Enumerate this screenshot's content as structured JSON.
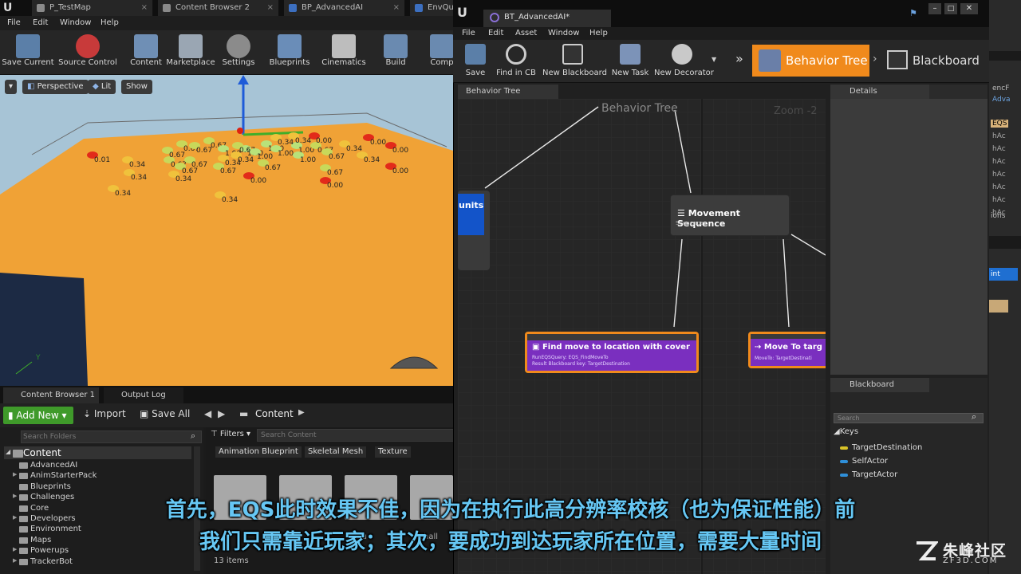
{
  "main_window": {
    "tabs": [
      "P_TestMap",
      "Content Browser 2",
      "BP_AdvancedAI",
      "EnvQu"
    ],
    "menu": [
      "File",
      "Edit",
      "Window",
      "Help"
    ],
    "toolbar": [
      "Save Current",
      "Source Control",
      "Content",
      "Marketplace",
      "Settings",
      "Blueprints",
      "Cinematics",
      "Build",
      "Comp"
    ],
    "viewport": {
      "buttons": [
        "Perspective",
        "Lit",
        "Show"
      ],
      "values": [
        "0.01",
        "0.34",
        "0.34",
        "0.34",
        "0.67",
        "0.67",
        "0.67",
        "0.67",
        "1.00",
        "1.00",
        "1.00",
        "1.00",
        "1.00",
        "0.67",
        "0.67",
        "0.67",
        "0.67",
        "0.67",
        "0.34",
        "0.34",
        "0.34",
        "0.34",
        "0.34",
        "0.00",
        "0.00",
        "0.00",
        "0.00",
        "0.00",
        "0.00",
        "0.34",
        "0.34",
        "0.67",
        "0.67",
        "1.00",
        "0.67",
        "0.34",
        "0.67",
        "1.00"
      ],
      "axis_label": "Y"
    },
    "content_browser": {
      "tabs": [
        "Content Browser 1",
        "Output Log"
      ],
      "add_new": "Add New",
      "import": "Import",
      "save_all": "Save All",
      "path": "Content",
      "search_folders": "Search Folders",
      "filters": "Filters",
      "search_content": "Search Content",
      "filter_chips": [
        "Animation Blueprint",
        "Skeletal Mesh",
        "Texture"
      ],
      "root": "Content",
      "folders": [
        "AdvancedAI",
        "AnimStarterPack",
        "Blueprints",
        "Challenges",
        "Core",
        "Developers",
        "Environment",
        "Maps",
        "Powerups",
        "TrackerBot"
      ],
      "asset_labels": [
        "Blu",
        "Chall"
      ],
      "items_count": "13 items"
    }
  },
  "bt_window": {
    "tab": "BT_AdvancedAI*",
    "menu": [
      "File",
      "Edit",
      "Asset",
      "Window",
      "Help"
    ],
    "toolbar": [
      "Save",
      "Find in CB",
      "New Blackboard",
      "New Task",
      "New Decorator"
    ],
    "modes": [
      "Behavior Tree",
      "Blackboard"
    ],
    "graph_tab": "Behavior Tree",
    "graph_title": "Behavior Tree",
    "zoom": "Zoom -2",
    "nodes": {
      "left_node_label": "units",
      "sequence": {
        "title": "Movement Sequence",
        "subtitle": "Sequence"
      },
      "find_move": {
        "title": "Find move to location with cover",
        "line1": "RunEQSQuery: EQS_FindMoveTo",
        "line2": "Result Blackboard key: TargetDestination"
      },
      "move_to": {
        "title": "Move To targ",
        "line1": "MoveTo: TargetDestinati"
      }
    },
    "details_tab": "Details",
    "blackboard_tab": "Blackboard",
    "blackboard_search": "Search",
    "keys_header": "Keys",
    "keys": [
      {
        "name": "TargetDestination",
        "color": "#d8c227"
      },
      {
        "name": "SelfActor",
        "color": "#2f8fd8"
      },
      {
        "name": "TargetActor",
        "color": "#2f8fd8"
      }
    ]
  },
  "right_edge": {
    "labels": [
      "encF",
      "Adva",
      "EQS",
      "hAc",
      "hAc",
      "hAc",
      "hAc",
      "hAc",
      "hAc",
      "hAc",
      "ions",
      "int"
    ]
  },
  "subtitles": {
    "line1": "首先，EQS此时效果不佳，因为在执行此高分辨率校核（也为保证性能）前",
    "line2": "我们只需靠近玩家；其次，要成功到达玩家所在位置，需要大量时间"
  },
  "watermark": {
    "brand": "朱峰社区",
    "url": "ZF3D.COM"
  },
  "colors": {
    "accent_orange": "#f08a1c",
    "node_purple": "#7a2fbf",
    "node_blue": "#1354c9",
    "add_new_green": "#3f9a2a"
  }
}
